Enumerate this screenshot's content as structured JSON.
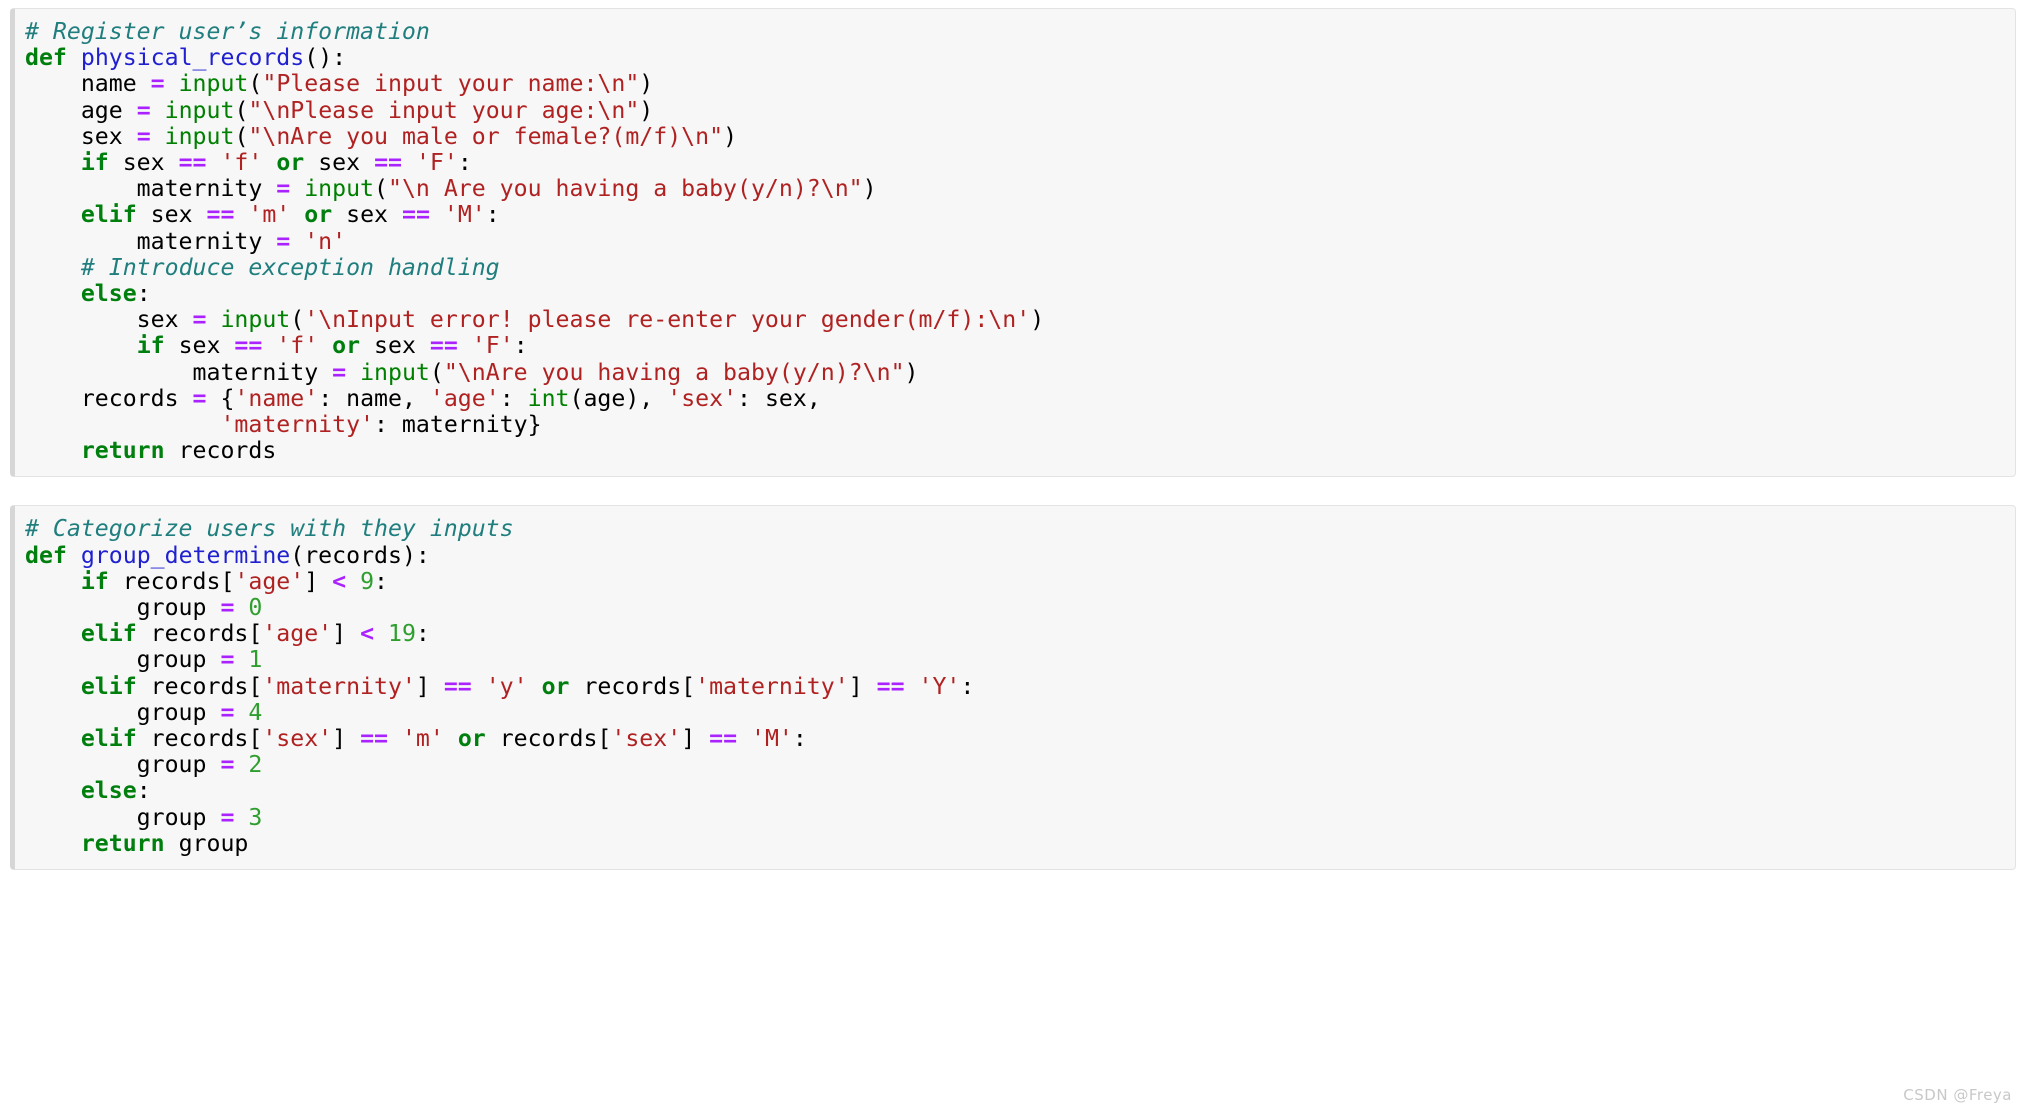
{
  "watermark": "CSDN @Freya",
  "colors": {
    "background": "#ffffff",
    "block_background": "#f7f7f7",
    "block_border": "#e3e3e3",
    "block_accent": "#d6d6d6",
    "comment": "#207e7e",
    "keyword": "#007f0e",
    "function_name": "#2020d0",
    "builtin": "#008000",
    "string": "#b02222",
    "operator": "#aa22ff",
    "number": "#2f9e2f",
    "plain_text": "#000000",
    "watermark": "#c8c8c8"
  },
  "language": "python",
  "blocks": [
    {
      "name": "physical-records-function",
      "lines": [
        [
          {
            "t": "comment",
            "v": "# Register user’s information"
          }
        ],
        [
          {
            "t": "keyword",
            "v": "def"
          },
          {
            "t": "plain",
            "v": " "
          },
          {
            "t": "func",
            "v": "physical_records"
          },
          {
            "t": "plain",
            "v": "():"
          }
        ],
        [
          {
            "t": "plain",
            "v": "    name "
          },
          {
            "t": "operator",
            "v": "="
          },
          {
            "t": "plain",
            "v": " "
          },
          {
            "t": "builtin",
            "v": "input"
          },
          {
            "t": "plain",
            "v": "("
          },
          {
            "t": "string",
            "v": "\"Please input your name:\\n\""
          },
          {
            "t": "plain",
            "v": ")"
          }
        ],
        [
          {
            "t": "plain",
            "v": "    age "
          },
          {
            "t": "operator",
            "v": "="
          },
          {
            "t": "plain",
            "v": " "
          },
          {
            "t": "builtin",
            "v": "input"
          },
          {
            "t": "plain",
            "v": "("
          },
          {
            "t": "string",
            "v": "\"\\nPlease input your age:\\n\""
          },
          {
            "t": "plain",
            "v": ")"
          }
        ],
        [
          {
            "t": "plain",
            "v": "    sex "
          },
          {
            "t": "operator",
            "v": "="
          },
          {
            "t": "plain",
            "v": " "
          },
          {
            "t": "builtin",
            "v": "input"
          },
          {
            "t": "plain",
            "v": "("
          },
          {
            "t": "string",
            "v": "\"\\nAre you male or female?(m/f)\\n\""
          },
          {
            "t": "plain",
            "v": ")"
          }
        ],
        [
          {
            "t": "plain",
            "v": "    "
          },
          {
            "t": "keyword",
            "v": "if"
          },
          {
            "t": "plain",
            "v": " sex "
          },
          {
            "t": "operator",
            "v": "=="
          },
          {
            "t": "plain",
            "v": " "
          },
          {
            "t": "string",
            "v": "'f'"
          },
          {
            "t": "plain",
            "v": " "
          },
          {
            "t": "keyword",
            "v": "or"
          },
          {
            "t": "plain",
            "v": " sex "
          },
          {
            "t": "operator",
            "v": "=="
          },
          {
            "t": "plain",
            "v": " "
          },
          {
            "t": "string",
            "v": "'F'"
          },
          {
            "t": "plain",
            "v": ":"
          }
        ],
        [
          {
            "t": "plain",
            "v": "        maternity "
          },
          {
            "t": "operator",
            "v": "="
          },
          {
            "t": "plain",
            "v": " "
          },
          {
            "t": "builtin",
            "v": "input"
          },
          {
            "t": "plain",
            "v": "("
          },
          {
            "t": "string",
            "v": "\"\\n Are you having a baby(y/n)?\\n\""
          },
          {
            "t": "plain",
            "v": ")"
          }
        ],
        [
          {
            "t": "plain",
            "v": "    "
          },
          {
            "t": "keyword",
            "v": "elif"
          },
          {
            "t": "plain",
            "v": " sex "
          },
          {
            "t": "operator",
            "v": "=="
          },
          {
            "t": "plain",
            "v": " "
          },
          {
            "t": "string",
            "v": "'m'"
          },
          {
            "t": "plain",
            "v": " "
          },
          {
            "t": "keyword",
            "v": "or"
          },
          {
            "t": "plain",
            "v": " sex "
          },
          {
            "t": "operator",
            "v": "=="
          },
          {
            "t": "plain",
            "v": " "
          },
          {
            "t": "string",
            "v": "'M'"
          },
          {
            "t": "plain",
            "v": ":"
          }
        ],
        [
          {
            "t": "plain",
            "v": "        maternity "
          },
          {
            "t": "operator",
            "v": "="
          },
          {
            "t": "plain",
            "v": " "
          },
          {
            "t": "string",
            "v": "'n'"
          }
        ],
        [
          {
            "t": "plain",
            "v": "    "
          },
          {
            "t": "comment",
            "v": "# Introduce exception handling"
          }
        ],
        [
          {
            "t": "plain",
            "v": "    "
          },
          {
            "t": "keyword",
            "v": "else"
          },
          {
            "t": "plain",
            "v": ":"
          }
        ],
        [
          {
            "t": "plain",
            "v": "        sex "
          },
          {
            "t": "operator",
            "v": "="
          },
          {
            "t": "plain",
            "v": " "
          },
          {
            "t": "builtin",
            "v": "input"
          },
          {
            "t": "plain",
            "v": "("
          },
          {
            "t": "string",
            "v": "'\\nInput error! please re-enter your gender(m/f):\\n'"
          },
          {
            "t": "plain",
            "v": ")"
          }
        ],
        [
          {
            "t": "plain",
            "v": "        "
          },
          {
            "t": "keyword",
            "v": "if"
          },
          {
            "t": "plain",
            "v": " sex "
          },
          {
            "t": "operator",
            "v": "=="
          },
          {
            "t": "plain",
            "v": " "
          },
          {
            "t": "string",
            "v": "'f'"
          },
          {
            "t": "plain",
            "v": " "
          },
          {
            "t": "keyword",
            "v": "or"
          },
          {
            "t": "plain",
            "v": " sex "
          },
          {
            "t": "operator",
            "v": "=="
          },
          {
            "t": "plain",
            "v": " "
          },
          {
            "t": "string",
            "v": "'F'"
          },
          {
            "t": "plain",
            "v": ":"
          }
        ],
        [
          {
            "t": "plain",
            "v": "            maternity "
          },
          {
            "t": "operator",
            "v": "="
          },
          {
            "t": "plain",
            "v": " "
          },
          {
            "t": "builtin",
            "v": "input"
          },
          {
            "t": "plain",
            "v": "("
          },
          {
            "t": "string",
            "v": "\"\\nAre you having a baby(y/n)?\\n\""
          },
          {
            "t": "plain",
            "v": ")"
          }
        ],
        [
          {
            "t": "plain",
            "v": "    records "
          },
          {
            "t": "operator",
            "v": "="
          },
          {
            "t": "plain",
            "v": " {"
          },
          {
            "t": "string",
            "v": "'name'"
          },
          {
            "t": "plain",
            "v": ": name, "
          },
          {
            "t": "string",
            "v": "'age'"
          },
          {
            "t": "plain",
            "v": ": "
          },
          {
            "t": "builtin",
            "v": "int"
          },
          {
            "t": "plain",
            "v": "(age), "
          },
          {
            "t": "string",
            "v": "'sex'"
          },
          {
            "t": "plain",
            "v": ": sex,"
          }
        ],
        [
          {
            "t": "plain",
            "v": "              "
          },
          {
            "t": "string",
            "v": "'maternity'"
          },
          {
            "t": "plain",
            "v": ": maternity}"
          }
        ],
        [
          {
            "t": "plain",
            "v": "    "
          },
          {
            "t": "keyword",
            "v": "return"
          },
          {
            "t": "plain",
            "v": " records"
          }
        ]
      ]
    },
    {
      "name": "group-determine-function",
      "lines": [
        [
          {
            "t": "comment",
            "v": "# Categorize users with they inputs"
          }
        ],
        [
          {
            "t": "keyword",
            "v": "def"
          },
          {
            "t": "plain",
            "v": " "
          },
          {
            "t": "func",
            "v": "group_determine"
          },
          {
            "t": "plain",
            "v": "(records):"
          }
        ],
        [
          {
            "t": "plain",
            "v": "    "
          },
          {
            "t": "keyword",
            "v": "if"
          },
          {
            "t": "plain",
            "v": " records["
          },
          {
            "t": "string",
            "v": "'age'"
          },
          {
            "t": "plain",
            "v": "] "
          },
          {
            "t": "operator",
            "v": "<"
          },
          {
            "t": "plain",
            "v": " "
          },
          {
            "t": "number",
            "v": "9"
          },
          {
            "t": "plain",
            "v": ":"
          }
        ],
        [
          {
            "t": "plain",
            "v": "        group "
          },
          {
            "t": "operator",
            "v": "="
          },
          {
            "t": "plain",
            "v": " "
          },
          {
            "t": "number",
            "v": "0"
          }
        ],
        [
          {
            "t": "plain",
            "v": "    "
          },
          {
            "t": "keyword",
            "v": "elif"
          },
          {
            "t": "plain",
            "v": " records["
          },
          {
            "t": "string",
            "v": "'age'"
          },
          {
            "t": "plain",
            "v": "] "
          },
          {
            "t": "operator",
            "v": "<"
          },
          {
            "t": "plain",
            "v": " "
          },
          {
            "t": "number",
            "v": "19"
          },
          {
            "t": "plain",
            "v": ":"
          }
        ],
        [
          {
            "t": "plain",
            "v": "        group "
          },
          {
            "t": "operator",
            "v": "="
          },
          {
            "t": "plain",
            "v": " "
          },
          {
            "t": "number",
            "v": "1"
          }
        ],
        [
          {
            "t": "plain",
            "v": "    "
          },
          {
            "t": "keyword",
            "v": "elif"
          },
          {
            "t": "plain",
            "v": " records["
          },
          {
            "t": "string",
            "v": "'maternity'"
          },
          {
            "t": "plain",
            "v": "] "
          },
          {
            "t": "operator",
            "v": "=="
          },
          {
            "t": "plain",
            "v": " "
          },
          {
            "t": "string",
            "v": "'y'"
          },
          {
            "t": "plain",
            "v": " "
          },
          {
            "t": "keyword",
            "v": "or"
          },
          {
            "t": "plain",
            "v": " records["
          },
          {
            "t": "string",
            "v": "'maternity'"
          },
          {
            "t": "plain",
            "v": "] "
          },
          {
            "t": "operator",
            "v": "=="
          },
          {
            "t": "plain",
            "v": " "
          },
          {
            "t": "string",
            "v": "'Y'"
          },
          {
            "t": "plain",
            "v": ":"
          }
        ],
        [
          {
            "t": "plain",
            "v": "        group "
          },
          {
            "t": "operator",
            "v": "="
          },
          {
            "t": "plain",
            "v": " "
          },
          {
            "t": "number",
            "v": "4"
          }
        ],
        [
          {
            "t": "plain",
            "v": "    "
          },
          {
            "t": "keyword",
            "v": "elif"
          },
          {
            "t": "plain",
            "v": " records["
          },
          {
            "t": "string",
            "v": "'sex'"
          },
          {
            "t": "plain",
            "v": "] "
          },
          {
            "t": "operator",
            "v": "=="
          },
          {
            "t": "plain",
            "v": " "
          },
          {
            "t": "string",
            "v": "'m'"
          },
          {
            "t": "plain",
            "v": " "
          },
          {
            "t": "keyword",
            "v": "or"
          },
          {
            "t": "plain",
            "v": " records["
          },
          {
            "t": "string",
            "v": "'sex'"
          },
          {
            "t": "plain",
            "v": "] "
          },
          {
            "t": "operator",
            "v": "=="
          },
          {
            "t": "plain",
            "v": " "
          },
          {
            "t": "string",
            "v": "'M'"
          },
          {
            "t": "plain",
            "v": ":"
          }
        ],
        [
          {
            "t": "plain",
            "v": "        group "
          },
          {
            "t": "operator",
            "v": "="
          },
          {
            "t": "plain",
            "v": " "
          },
          {
            "t": "number",
            "v": "2"
          }
        ],
        [
          {
            "t": "plain",
            "v": "    "
          },
          {
            "t": "keyword",
            "v": "else"
          },
          {
            "t": "plain",
            "v": ":"
          }
        ],
        [
          {
            "t": "plain",
            "v": "        group "
          },
          {
            "t": "operator",
            "v": "="
          },
          {
            "t": "plain",
            "v": " "
          },
          {
            "t": "number",
            "v": "3"
          }
        ],
        [
          {
            "t": "plain",
            "v": "    "
          },
          {
            "t": "keyword",
            "v": "return"
          },
          {
            "t": "plain",
            "v": " group"
          }
        ]
      ]
    }
  ]
}
